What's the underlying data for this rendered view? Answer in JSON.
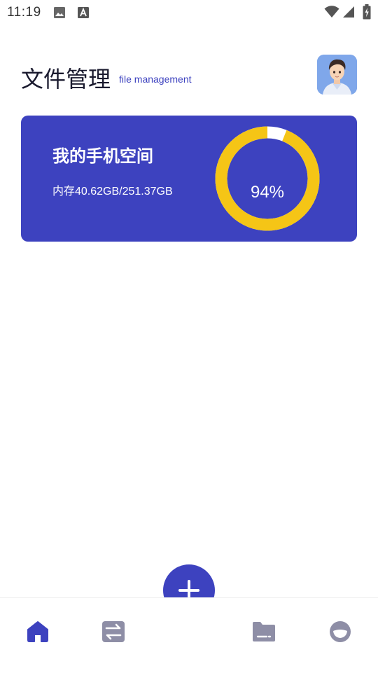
{
  "status_bar": {
    "time": "11:19",
    "icons": [
      "image-icon",
      "text-app-icon",
      "wifi-icon",
      "signal-icon",
      "battery-icon"
    ]
  },
  "header": {
    "title": "文件管理",
    "subtitle": "file management",
    "avatar": "user-avatar"
  },
  "storage": {
    "title": "我的手机空间",
    "usage": "内存40.62GB/251.37GB",
    "percent_label": "94%",
    "used_fraction": 0.94,
    "colors": {
      "card": "#3d42bf",
      "ring_used": "#f5c516",
      "ring_free": "#ffffff"
    }
  },
  "nav": {
    "items": [
      {
        "icon": "home-icon",
        "active": true
      },
      {
        "icon": "transfer-icon",
        "active": false
      },
      {
        "icon": "folder-icon",
        "active": false
      },
      {
        "icon": "profile-icon",
        "active": false
      }
    ],
    "fab_icon": "plus-icon",
    "active_color": "#3d42bf",
    "inactive_color": "#8e8ea6"
  }
}
